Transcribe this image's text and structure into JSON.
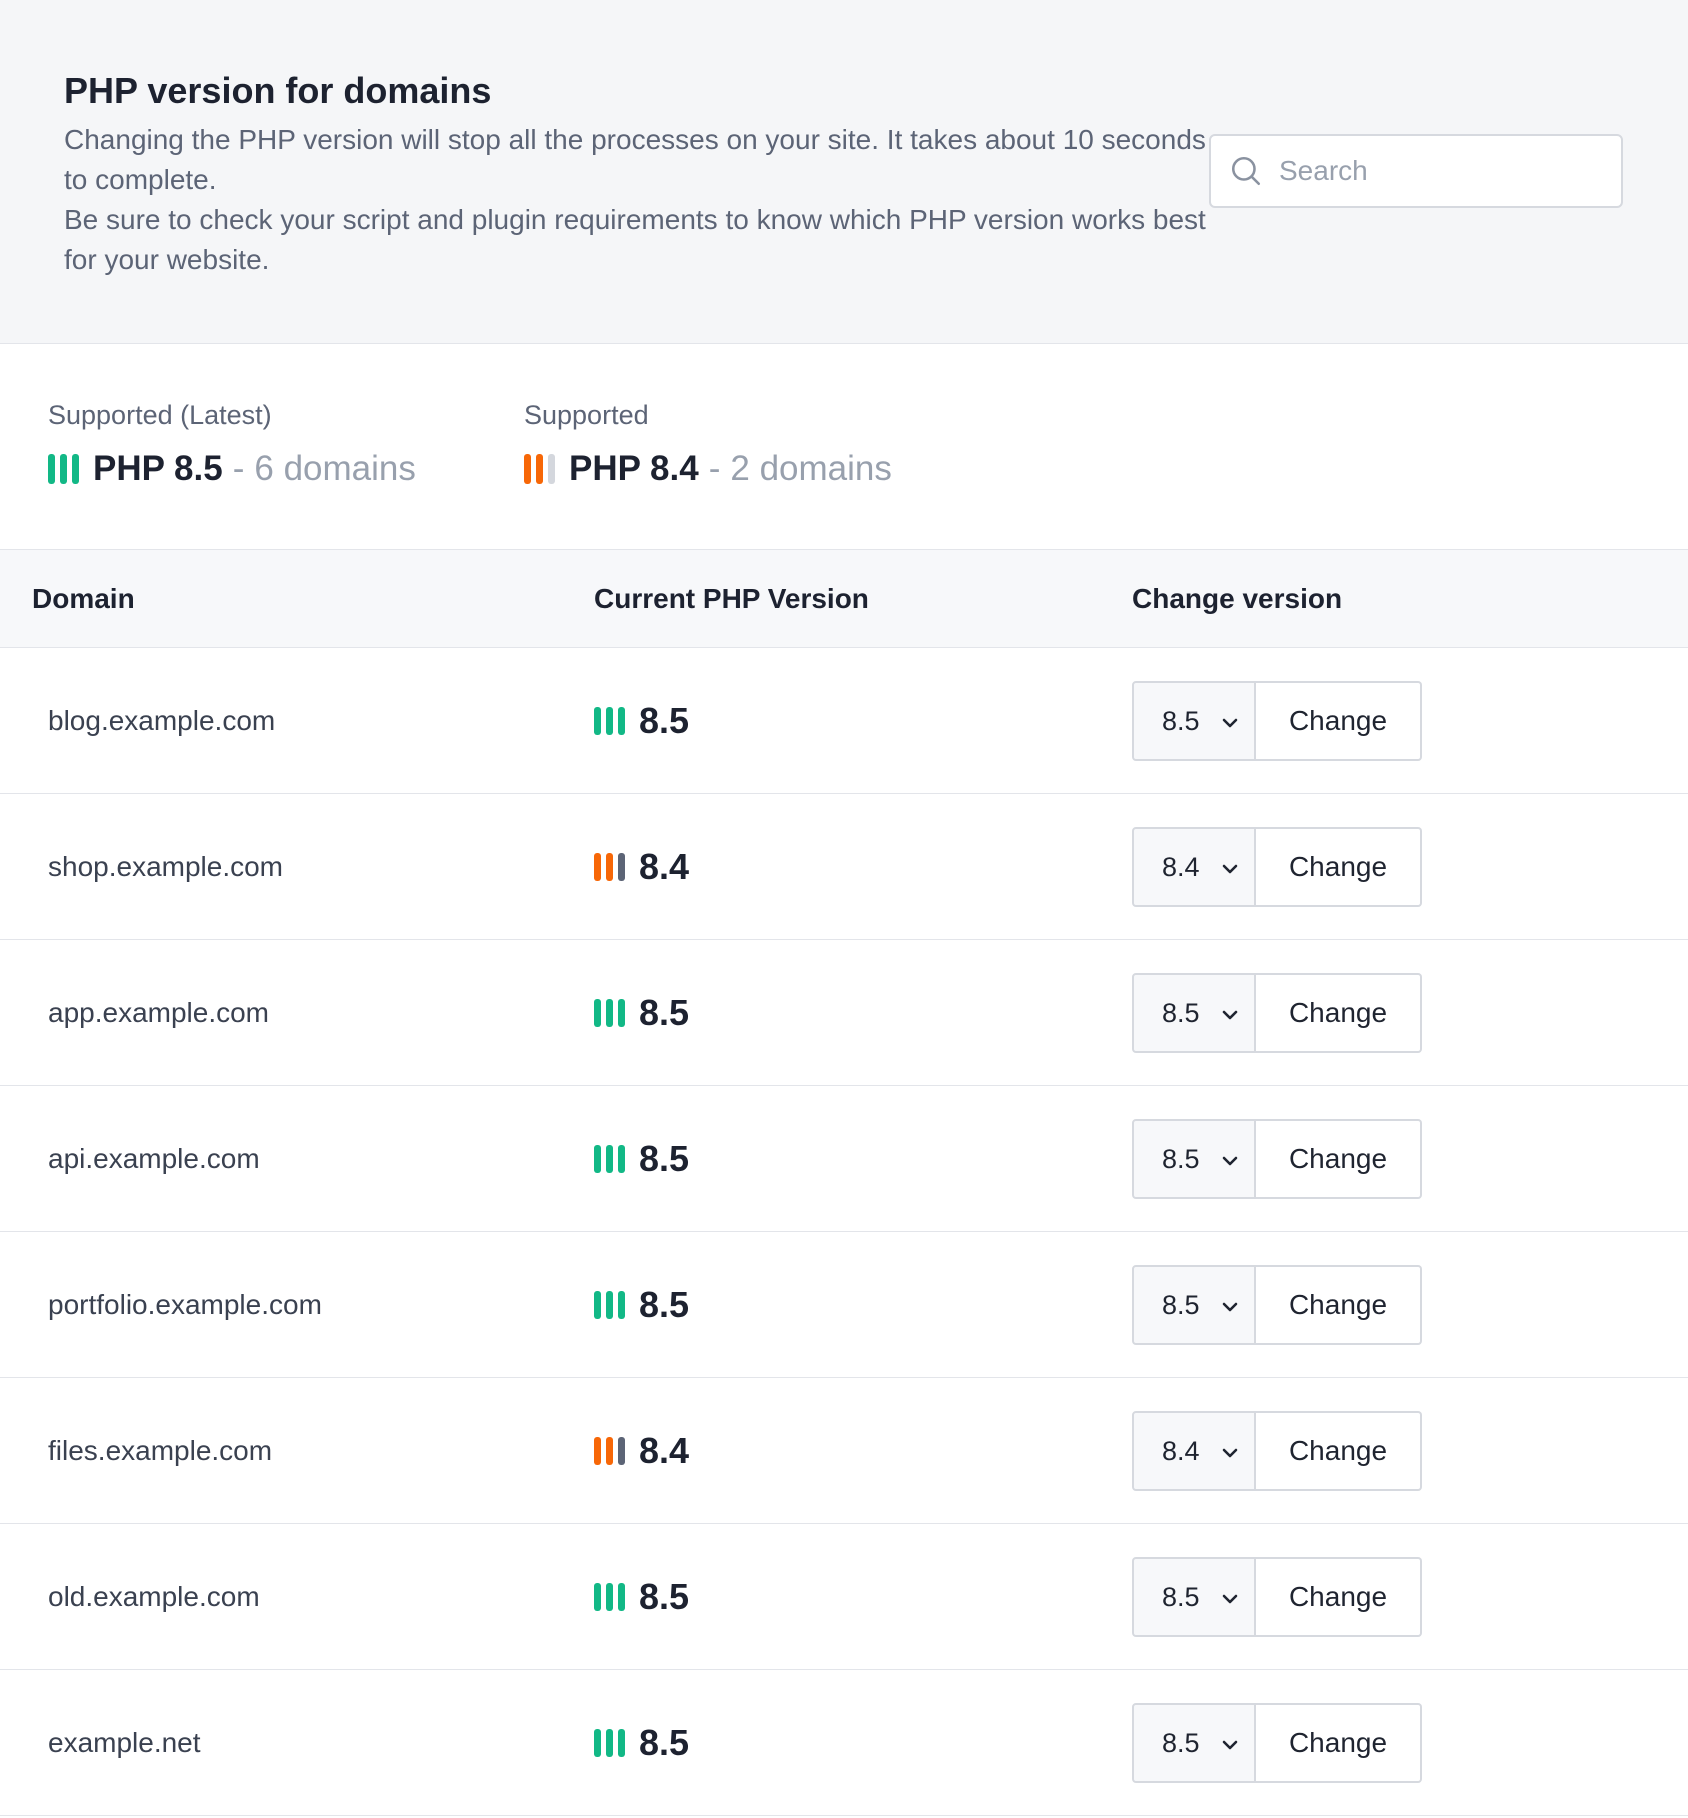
{
  "header": {
    "title": "PHP version for domains",
    "desc_line1": "Changing the PHP version will stop all the processes on your site. It takes about 10 seconds to complete.",
    "desc_line2": "Be sure to check your script and plugin requirements to know which PHP version works best for your website.",
    "search_placeholder": "Search",
    "search_value": ""
  },
  "summary": [
    {
      "label": "Supported (Latest)",
      "version": "PHP 8.5",
      "separator": "-",
      "count": "6 domains",
      "status_color": "#12b886"
    },
    {
      "label": "Supported",
      "version": "PHP 8.4",
      "separator": "-",
      "count": "2 domains",
      "status_color": "#f76707"
    }
  ],
  "table": {
    "columns": [
      "Domain",
      "Current PHP Version",
      "Change version"
    ],
    "button_label": "Change",
    "rows": [
      {
        "domain": "blog.example.com",
        "version": "8.5",
        "selected": "8.5",
        "status": "latest"
      },
      {
        "domain": "shop.example.com",
        "version": "8.4",
        "selected": "8.4",
        "status": "supported"
      },
      {
        "domain": "app.example.com",
        "version": "8.5",
        "selected": "8.5",
        "status": "latest"
      },
      {
        "domain": "api.example.com",
        "version": "8.5",
        "selected": "8.5",
        "status": "latest"
      },
      {
        "domain": "portfolio.example.com",
        "version": "8.5",
        "selected": "8.5",
        "status": "latest"
      },
      {
        "domain": "files.example.com",
        "version": "8.4",
        "selected": "8.4",
        "status": "supported"
      },
      {
        "domain": "old.example.com",
        "version": "8.5",
        "selected": "8.5",
        "status": "latest"
      },
      {
        "domain": "example.net",
        "version": "8.5",
        "selected": "8.5",
        "status": "latest"
      }
    ]
  },
  "icons": {
    "search": "search-icon",
    "status_bars": "php-status-bars-icon",
    "chevron": "chevron-down-icon"
  },
  "colors": {
    "latest": "#12b886",
    "supported": "#f76707",
    "muted": "#98a0ad"
  }
}
